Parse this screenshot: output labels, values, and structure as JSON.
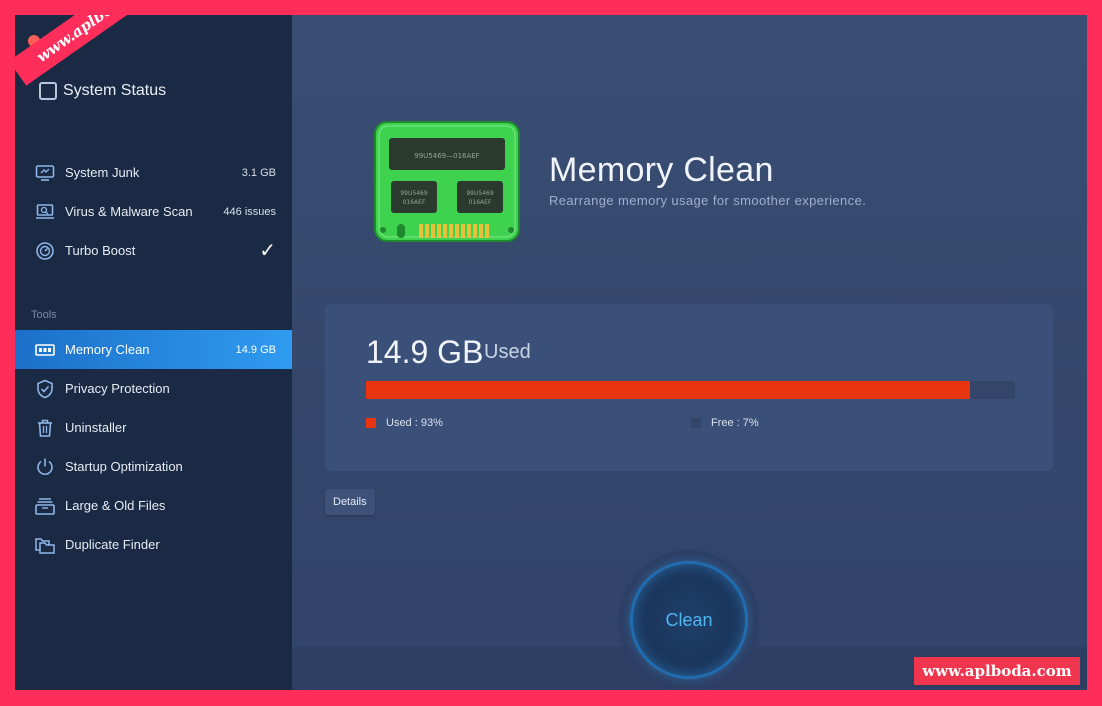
{
  "sidebar": {
    "system_status_label": "System Status",
    "items": [
      {
        "id": "system-junk",
        "label": "System Junk",
        "meta": "3.1 GB",
        "icon": "monitor-icon"
      },
      {
        "id": "virus-malware",
        "label": "Virus & Malware Scan",
        "meta": "446 issues",
        "icon": "laptop-scan-icon"
      },
      {
        "id": "turbo-boost",
        "label": "Turbo Boost",
        "meta": "✓",
        "icon": "speedometer-icon"
      }
    ],
    "tools_header": "Tools",
    "tools": [
      {
        "id": "memory-clean",
        "label": "Memory Clean",
        "meta": "14.9 GB",
        "icon": "memory-chip-icon",
        "active": true
      },
      {
        "id": "privacy-protection",
        "label": "Privacy Protection",
        "meta": "",
        "icon": "shield-check-icon"
      },
      {
        "id": "uninstaller",
        "label": "Uninstaller",
        "meta": "",
        "icon": "trash-icon"
      },
      {
        "id": "startup-optimization",
        "label": "Startup Optimization",
        "meta": "",
        "icon": "power-icon"
      },
      {
        "id": "large-old-files",
        "label": "Large & Old Files",
        "meta": "",
        "icon": "file-stack-icon"
      },
      {
        "id": "duplicate-finder",
        "label": "Duplicate Finder",
        "meta": "",
        "icon": "folder-duplicate-icon"
      }
    ]
  },
  "main": {
    "title": "Memory Clean",
    "subtitle": "Rearrange memory usage for smoother experience.",
    "ram_chip_label_top": "99U5469—016AEF",
    "ram_chip_label_a": "99U5469\n016AEF",
    "ram_chip_label_b": "99U5469\n016AEF",
    "usage": {
      "amount": "14.9 GB",
      "unit_label": "Used",
      "used_fraction": 0.93,
      "used_legend": "Used : 93%",
      "free_legend": "Free : 7%",
      "used_color": "#e9350f",
      "free_color": "#33466a"
    },
    "details_label": "Details",
    "clean_label": "Clean"
  },
  "watermarks": {
    "top_left": "www.aplboda.com",
    "bottom_right": "www.aplboda.com"
  },
  "colors": {
    "accent": "#2f9bf0",
    "sidebar_bg": "#1b2a44",
    "main_bg": "#34466a"
  }
}
